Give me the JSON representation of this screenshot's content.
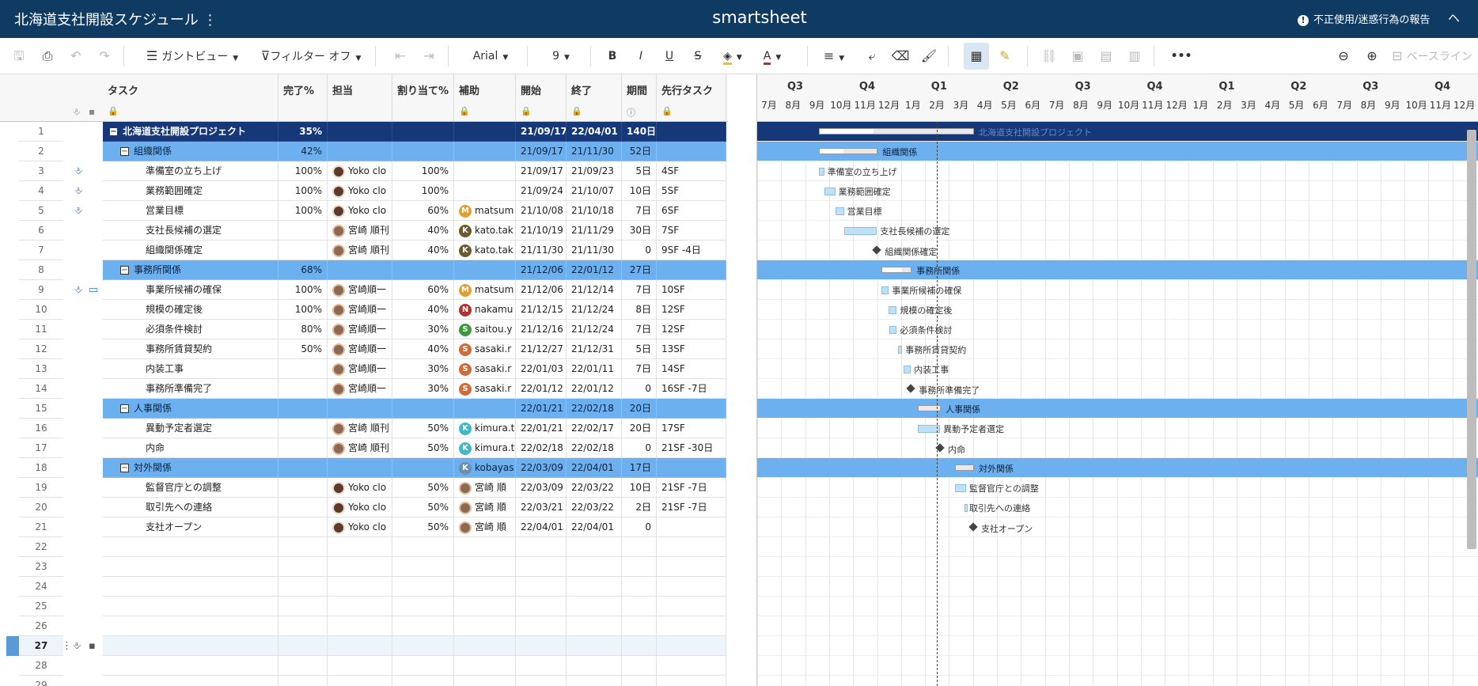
{
  "app": {
    "title": "北海道支社開設スケジュール",
    "brand": "smartsheet",
    "report": "不正使用/迷惑行為の報告",
    "help": "ヘ"
  },
  "toolbar": {
    "gantt_view": "ガントビュー",
    "filter": "フィルター オフ",
    "font": "Arial",
    "font_size": "9",
    "baseline": "ベースライン",
    "icons": [
      "save-icon",
      "print-icon",
      "undo-icon",
      "redo-icon",
      "gantt-view-icon",
      "filter-icon",
      "outdent-icon",
      "indent-icon",
      "bold-icon",
      "italic-icon",
      "underline-icon",
      "strikethrough-icon",
      "fill-color-icon",
      "text-color-icon",
      "align-icon",
      "wrap-icon",
      "clear-format-icon",
      "format-painter-icon",
      "grid-view-icon",
      "highlight-icon",
      "link-icon",
      "image-icon",
      "card-icon",
      "more-icon",
      "zoom-out-icon",
      "zoom-in-icon"
    ]
  },
  "columns": {
    "task": "タスク",
    "pct": "完了%",
    "assignee": "担当",
    "alloc": "割り当て%",
    "assist": "補助",
    "start": "開始",
    "end": "終了",
    "duration": "期間",
    "pred": "先行タスク"
  },
  "gantt": {
    "quarters": [
      "Q3",
      "Q4",
      "Q1",
      "Q2",
      "Q3",
      "Q4",
      "Q1",
      "Q2",
      "Q3",
      "Q4"
    ],
    "months": [
      "7月",
      "8月",
      "9月",
      "10月",
      "11月",
      "12月",
      "1月",
      "2月",
      "3月",
      "4月",
      "5月",
      "6月",
      "7月",
      "8月",
      "9月",
      "10月",
      "11月",
      "12月",
      "1月",
      "2月",
      "3月",
      "4月",
      "5月",
      "6月",
      "7月",
      "8月",
      "9月",
      "10月",
      "11月",
      "12月"
    ]
  },
  "rows": [
    {
      "n": "1",
      "type": "proj",
      "task": "北海道支社開設プロジェクト",
      "pct": "35%",
      "assignee": "",
      "alloc": "",
      "assist": "",
      "start": "21/09/17",
      "end": "22/04/01",
      "dur": "140日",
      "pred": "",
      "att": false,
      "cmt": false
    },
    {
      "n": "2",
      "type": "grp",
      "task": "組織関係",
      "pct": "42%",
      "assignee": "",
      "alloc": "",
      "assist": "",
      "start": "21/09/17",
      "end": "21/11/30",
      "dur": "52日",
      "pred": "",
      "att": false,
      "cmt": false
    },
    {
      "n": "3",
      "type": "task",
      "task": "準備室の立ち上げ",
      "pct": "100%",
      "assignee": "Yoko clo",
      "av": "phw",
      "alloc": "100%",
      "assist": "",
      "start": "21/09/17",
      "end": "21/09/23",
      "dur": "5日",
      "pred": "4SF",
      "att": true,
      "cmt": false
    },
    {
      "n": "4",
      "type": "task",
      "task": "業務範囲確定",
      "pct": "100%",
      "assignee": "Yoko clo",
      "av": "phw",
      "alloc": "100%",
      "assist": "",
      "start": "21/09/24",
      "end": "21/10/07",
      "dur": "10日",
      "pred": "5SF",
      "att": true,
      "cmt": false
    },
    {
      "n": "5",
      "type": "task",
      "task": "営業目標",
      "pct": "100%",
      "assignee": "Yoko clo",
      "av": "phw",
      "alloc": "60%",
      "assist": "matsum",
      "asc": "#e0a030",
      "asi": "M",
      "start": "21/10/08",
      "end": "21/10/18",
      "dur": "7日",
      "pred": "6SF",
      "att": true,
      "cmt": false
    },
    {
      "n": "6",
      "type": "task",
      "task": "支社長候補の選定",
      "pct": "",
      "assignee": "宮崎 順刊",
      "av": "ph",
      "alloc": "40%",
      "assist": "kato.tak",
      "asc": "#6b5a2e",
      "asi": "K",
      "start": "21/10/19",
      "end": "21/11/29",
      "dur": "30日",
      "pred": "7SF",
      "att": false,
      "cmt": false
    },
    {
      "n": "7",
      "type": "task",
      "task": "組織関係確定",
      "pct": "",
      "assignee": "宮崎 順刊",
      "av": "ph",
      "alloc": "40%",
      "assist": "kato.tak",
      "asc": "#6b5a2e",
      "asi": "K",
      "start": "21/11/30",
      "end": "21/11/30",
      "dur": "0",
      "pred": "9SF -4日",
      "att": false,
      "cmt": false
    },
    {
      "n": "8",
      "type": "grp",
      "task": "事務所関係",
      "pct": "68%",
      "assignee": "",
      "alloc": "",
      "assist": "",
      "start": "21/12/06",
      "end": "22/01/12",
      "dur": "27日",
      "pred": "",
      "att": false,
      "cmt": false
    },
    {
      "n": "9",
      "type": "task",
      "task": "事業所候補の確保",
      "pct": "100%",
      "assignee": "宮崎順一",
      "av": "ph",
      "alloc": "60%",
      "assist": "matsum",
      "asc": "#e0a030",
      "asi": "M",
      "start": "21/12/06",
      "end": "21/12/14",
      "dur": "7日",
      "pred": "10SF",
      "att": true,
      "cmt": true
    },
    {
      "n": "10",
      "type": "task",
      "task": "規模の確定後",
      "pct": "100%",
      "assignee": "宮崎順一",
      "av": "ph",
      "alloc": "40%",
      "assist": "nakamu",
      "asc": "#b03030",
      "asi": "N",
      "start": "21/12/15",
      "end": "21/12/24",
      "dur": "8日",
      "pred": "12SF",
      "att": false,
      "cmt": false
    },
    {
      "n": "11",
      "type": "task",
      "task": "必須条件検討",
      "pct": "80%",
      "assignee": "宮崎順一",
      "av": "ph",
      "alloc": "30%",
      "assist": "saitou.y",
      "asc": "#3a9a3a",
      "asi": "S",
      "start": "21/12/16",
      "end": "21/12/24",
      "dur": "7日",
      "pred": "12SF",
      "att": false,
      "cmt": false
    },
    {
      "n": "12",
      "type": "task",
      "task": "事務所賃貸契約",
      "pct": "50%",
      "assignee": "宮崎順一",
      "av": "ph",
      "alloc": "40%",
      "assist": "sasaki.r",
      "asc": "#d06a3a",
      "asi": "S",
      "start": "21/12/27",
      "end": "21/12/31",
      "dur": "5日",
      "pred": "13SF",
      "att": false,
      "cmt": false
    },
    {
      "n": "13",
      "type": "task",
      "task": "内装工事",
      "pct": "",
      "assignee": "宮崎順一",
      "av": "ph",
      "alloc": "30%",
      "assist": "sasaki.r",
      "asc": "#d06a3a",
      "asi": "S",
      "start": "22/01/03",
      "end": "22/01/11",
      "dur": "7日",
      "pred": "14SF",
      "att": false,
      "cmt": false
    },
    {
      "n": "14",
      "type": "task",
      "task": "事務所準備完了",
      "pct": "",
      "assignee": "宮崎順一",
      "av": "ph",
      "alloc": "30%",
      "assist": "sasaki.r",
      "asc": "#d06a3a",
      "asi": "S",
      "start": "22/01/12",
      "end": "22/01/12",
      "dur": "0",
      "pred": "16SF -7日",
      "att": false,
      "cmt": false
    },
    {
      "n": "15",
      "type": "grp",
      "task": "人事関係",
      "pct": "",
      "assignee": "",
      "alloc": "",
      "assist": "",
      "start": "22/01/21",
      "end": "22/02/18",
      "dur": "20日",
      "pred": "",
      "att": false,
      "cmt": false
    },
    {
      "n": "16",
      "type": "task",
      "task": "異動予定者選定",
      "pct": "",
      "assignee": "宮崎 順刊",
      "av": "ph",
      "alloc": "50%",
      "assist": "kimura.t",
      "asc": "#3fb8c8",
      "asi": "K",
      "start": "22/01/21",
      "end": "22/02/17",
      "dur": "20日",
      "pred": "17SF",
      "att": false,
      "cmt": false
    },
    {
      "n": "17",
      "type": "task",
      "task": "内命",
      "pct": "",
      "assignee": "宮崎 順刊",
      "av": "ph",
      "alloc": "50%",
      "assist": "kimura.t",
      "asc": "#3fb8c8",
      "asi": "K",
      "start": "22/02/18",
      "end": "22/02/18",
      "dur": "0",
      "pred": "21SF -30日",
      "att": false,
      "cmt": false
    },
    {
      "n": "18",
      "type": "grp",
      "task": "対外関係",
      "pct": "",
      "assignee": "",
      "alloc": "",
      "assist": "kobayas",
      "asc": "#6f8fb0",
      "asi": "K",
      "start": "22/03/09",
      "end": "22/04/01",
      "dur": "17日",
      "pred": "",
      "att": false,
      "cmt": false
    },
    {
      "n": "19",
      "type": "task",
      "task": "監督官庁との調整",
      "pct": "",
      "assignee": "Yoko clo",
      "av": "phw",
      "alloc": "50%",
      "assist": "宮崎 順",
      "asc": "ph",
      "start": "22/03/09",
      "end": "22/03/22",
      "dur": "10日",
      "pred": "21SF -7日",
      "att": false,
      "cmt": false
    },
    {
      "n": "20",
      "type": "task",
      "task": "取引先への連絡",
      "pct": "",
      "assignee": "Yoko clo",
      "av": "phw",
      "alloc": "50%",
      "assist": "宮崎 順",
      "asc": "ph",
      "start": "22/03/21",
      "end": "22/03/22",
      "dur": "2日",
      "pred": "21SF -7日",
      "att": false,
      "cmt": false
    },
    {
      "n": "21",
      "type": "task",
      "task": "支社オープン",
      "pct": "",
      "assignee": "Yoko clo",
      "av": "phw",
      "alloc": "50%",
      "assist": "宮崎 順",
      "asc": "ph",
      "start": "22/04/01",
      "end": "22/04/01",
      "dur": "0",
      "pred": "",
      "att": false,
      "cmt": false
    },
    {
      "n": "22",
      "type": "empty"
    },
    {
      "n": "23",
      "type": "empty"
    },
    {
      "n": "24",
      "type": "empty"
    },
    {
      "n": "25",
      "type": "empty"
    },
    {
      "n": "26",
      "type": "empty"
    },
    {
      "n": "27",
      "type": "empty",
      "sel": true
    },
    {
      "n": "28",
      "type": "empty"
    },
    {
      "n": "29",
      "type": "empty"
    }
  ],
  "chart_data": {
    "type": "gantt",
    "axis_start": "2021-07-01",
    "bars": [
      {
        "row": 1,
        "label": "北海道支社開設プロジェクト",
        "start": "2021-09-17",
        "end": "2022-04-01",
        "kind": "summary",
        "progress": 0.35
      },
      {
        "row": 2,
        "label": "組織関係",
        "start": "2021-09-17",
        "end": "2021-11-30",
        "kind": "summary",
        "progress": 0.42
      },
      {
        "row": 3,
        "label": "準備室の立ち上げ",
        "start": "2021-09-17",
        "end": "2021-09-23",
        "kind": "task"
      },
      {
        "row": 4,
        "label": "業務範囲確定",
        "start": "2021-09-24",
        "end": "2021-10-07",
        "kind": "task"
      },
      {
        "row": 5,
        "label": "営業目標",
        "start": "2021-10-08",
        "end": "2021-10-18",
        "kind": "task"
      },
      {
        "row": 6,
        "label": "支社長候補の選定",
        "start": "2021-10-19",
        "end": "2021-11-29",
        "kind": "task"
      },
      {
        "row": 7,
        "label": "組織関係確定",
        "start": "2021-11-30",
        "end": "2021-11-30",
        "kind": "milestone"
      },
      {
        "row": 8,
        "label": "事務所関係",
        "start": "2021-12-06",
        "end": "2022-01-12",
        "kind": "summary",
        "progress": 0.68
      },
      {
        "row": 9,
        "label": "事業所候補の確保",
        "start": "2021-12-06",
        "end": "2021-12-14",
        "kind": "task"
      },
      {
        "row": 10,
        "label": "規模の確定後",
        "start": "2021-12-15",
        "end": "2021-12-24",
        "kind": "task"
      },
      {
        "row": 11,
        "label": "必須条件検討",
        "start": "2021-12-16",
        "end": "2021-12-24",
        "kind": "task"
      },
      {
        "row": 12,
        "label": "事務所賃貸契約",
        "start": "2021-12-27",
        "end": "2021-12-31",
        "kind": "task"
      },
      {
        "row": 13,
        "label": "内装工事",
        "start": "2022-01-03",
        "end": "2022-01-11",
        "kind": "task"
      },
      {
        "row": 14,
        "label": "事務所準備完了",
        "start": "2022-01-12",
        "end": "2022-01-12",
        "kind": "milestone"
      },
      {
        "row": 15,
        "label": "人事関係",
        "start": "2022-01-21",
        "end": "2022-02-18",
        "kind": "summary",
        "progress": 0
      },
      {
        "row": 16,
        "label": "異動予定者選定",
        "start": "2022-01-21",
        "end": "2022-02-17",
        "kind": "task"
      },
      {
        "row": 17,
        "label": "内命",
        "start": "2022-02-18",
        "end": "2022-02-18",
        "kind": "milestone"
      },
      {
        "row": 18,
        "label": "対外関係",
        "start": "2022-03-09",
        "end": "2022-04-01",
        "kind": "summary",
        "progress": 0
      },
      {
        "row": 19,
        "label": "監督官庁との調整",
        "start": "2022-03-09",
        "end": "2022-03-22",
        "kind": "task"
      },
      {
        "row": 20,
        "label": "取引先への連絡",
        "start": "2022-03-21",
        "end": "2022-03-22",
        "kind": "task"
      },
      {
        "row": 21,
        "label": "支社オープン",
        "start": "2022-04-01",
        "end": "2022-04-01",
        "kind": "milestone"
      }
    ],
    "today": "2022-02-14"
  }
}
